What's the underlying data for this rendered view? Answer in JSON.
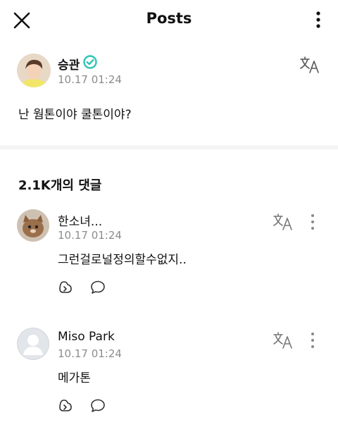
{
  "header": {
    "title": "Posts",
    "close_icon": "close-icon",
    "more_icon": "more-vertical-icon"
  },
  "post": {
    "author": "승관",
    "time": "10.17 01:24",
    "body": "난 웜톤이야 쿨톤이야?",
    "verified_color": "#2EC4B6"
  },
  "comments_header": "2.1K개의 댓글",
  "comments": [
    {
      "name": "한소녀...",
      "time": "10.17 01:24",
      "text": "그런걸로널정의할수없지.."
    },
    {
      "name": "Miso Park",
      "time": "10.17 01:24",
      "text": "메가톤"
    }
  ],
  "icons": {
    "translate": "translate-icon",
    "reply": "reply-icon",
    "comment": "comment-bubble-icon"
  }
}
